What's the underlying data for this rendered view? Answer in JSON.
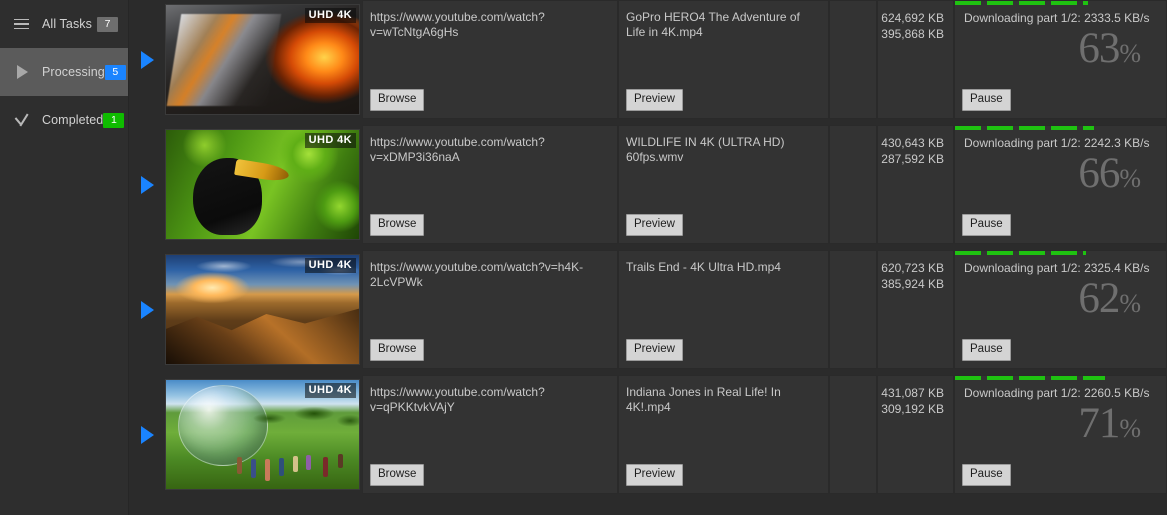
{
  "sidebar": {
    "items": [
      {
        "label": "All Tasks",
        "count": "7",
        "icon": "hamburger-icon",
        "badge_color": "#6e6e6e",
        "active": false
      },
      {
        "label": "Processing",
        "count": "5",
        "icon": "play-icon",
        "badge_color": "#1a84ff",
        "active": true
      },
      {
        "label": "Completed",
        "count": "1",
        "icon": "check-icon",
        "badge_color": "#0fbc00",
        "active": false
      }
    ]
  },
  "common": {
    "browse_label": "Browse",
    "preview_label": "Preview",
    "pause_label": "Pause",
    "quality_badge": "UHD 4K",
    "play_icon": "play-triangle-icon",
    "accent_blue": "#1a84ff",
    "progress_green": "#1fc211"
  },
  "tasks": [
    {
      "url": "https://www.youtube.com/watch?v=wTcNtgA6gHs",
      "title": "GoPro HERO4  The Adventure of Life in 4K.mp4",
      "size_total": "624,692 KB",
      "size_done": "395,868 KB",
      "status": "Downloading part 1/2: 2333.5 KB/s",
      "percent": "63",
      "percent_sign": "%",
      "progress_value": 63,
      "thumb": "volcano-foundry-thumbnail",
      "art_class": "art-volcano"
    },
    {
      "url": "https://www.youtube.com/watch?v=xDMP3i36naA",
      "title": "WILDLIFE IN 4K (ULTRA HD) 60fps.wmv",
      "size_total": "430,643 KB",
      "size_done": "287,592 KB",
      "status": "Downloading part 1/2: 2242.3 KB/s",
      "percent": "66",
      "percent_sign": "%",
      "progress_value": 66,
      "thumb": "hornbill-bird-thumbnail",
      "art_class": "art-bird"
    },
    {
      "url": "https://www.youtube.com/watch?v=h4K-2LcVPWk",
      "title": "Trails End - 4K Ultra HD.mp4",
      "size_total": "620,723 KB",
      "size_done": "385,924 KB",
      "status": "Downloading part 1/2: 2325.4 KB/s",
      "percent": "62",
      "percent_sign": "%",
      "progress_value": 62,
      "thumb": "canyon-sunset-thumbnail",
      "art_class": "art-canyon"
    },
    {
      "url": "https://www.youtube.com/watch?v=qPKKtvkVAjY",
      "title": "Indiana Jones in Real Life! In 4K!.mp4",
      "size_total": "431,087 KB",
      "size_done": "309,192 KB",
      "status": "Downloading part 1/2: 2260.5 KB/s",
      "percent": "71",
      "percent_sign": "%",
      "progress_value": 71,
      "thumb": "zorb-ball-hill-thumbnail",
      "art_class": "art-zorb"
    }
  ]
}
